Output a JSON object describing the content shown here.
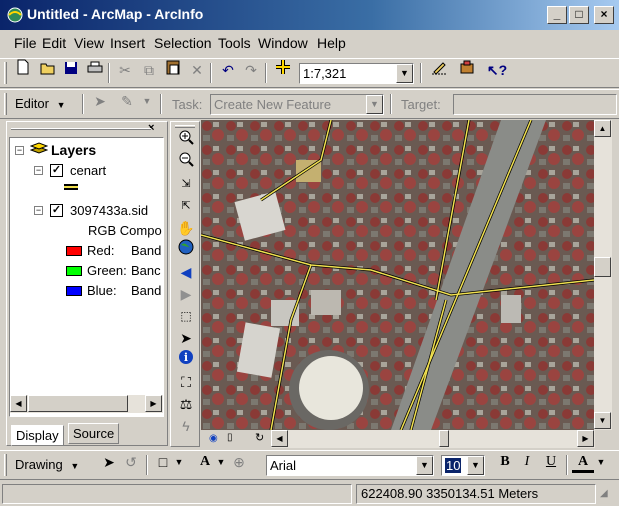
{
  "window": {
    "title": "Untitled - ArcMap - ArcInfo",
    "controls": [
      "_",
      "□",
      "×"
    ]
  },
  "menu": [
    "File",
    "Edit",
    "View",
    "Insert",
    "Selection",
    "Tools",
    "Window",
    "Help"
  ],
  "standard_toolbar": {
    "scale": "1:7,321"
  },
  "editor_toolbar": {
    "editor_label": "Editor",
    "task_label": "Task:",
    "task_value": "Create New Feature",
    "target_label": "Target:",
    "target_value": ""
  },
  "toc": {
    "root": "Layers",
    "layers": [
      {
        "name": "cenart",
        "checked": true
      },
      {
        "name": "3097433a.sid",
        "checked": true,
        "renderer": "RGB Compo",
        "bands": [
          {
            "label": "Red:",
            "value": "Band",
            "color": "#ff0000"
          },
          {
            "label": "Green:",
            "value": "Banc",
            "color": "#00ff00"
          },
          {
            "label": "Blue:",
            "value": "Band",
            "color": "#0000ff"
          }
        ]
      }
    ],
    "tabs": [
      "Display",
      "Source"
    ]
  },
  "drawing_toolbar": {
    "drawing_label": "Drawing",
    "font_name": "Arial",
    "font_size": "10",
    "bold": "B",
    "italic": "I",
    "underline": "U",
    "text_tool": "A"
  },
  "status": {
    "coordinates": "622408.90  3350134.51 Meters"
  },
  "colors": {
    "titlebar": "#0a246a",
    "road_yellow": "#f0e050",
    "selection": "#0a246a"
  }
}
